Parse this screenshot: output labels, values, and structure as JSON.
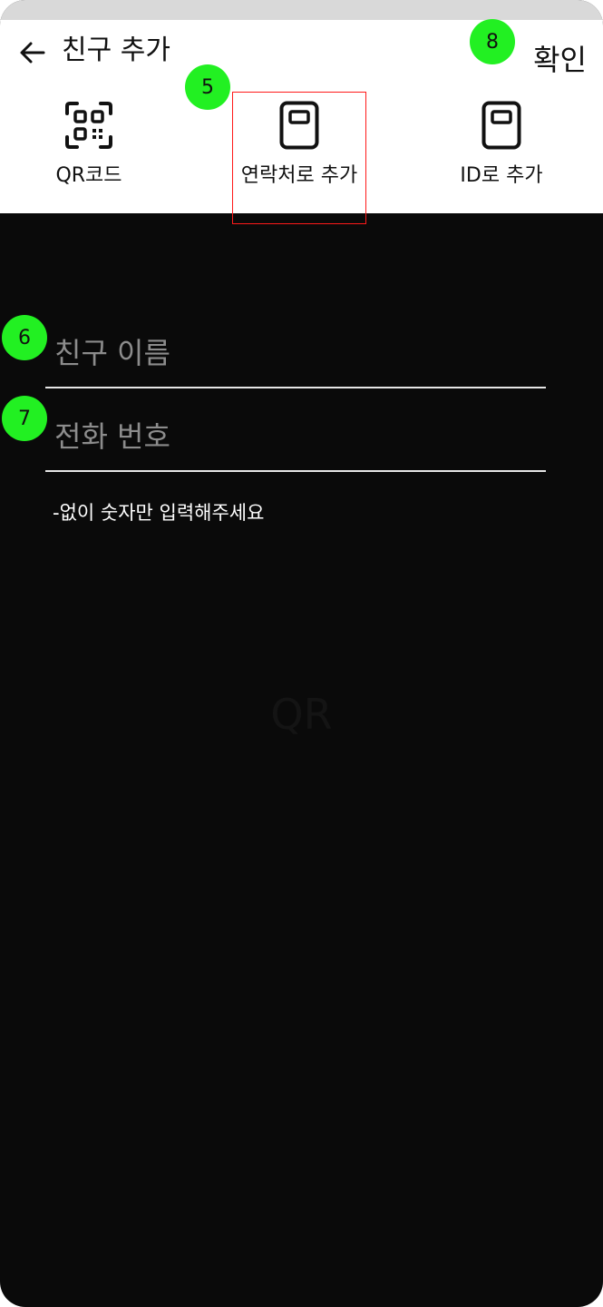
{
  "header": {
    "title": "친구 추가",
    "confirm_label": "확인",
    "back_icon": "arrow-left-icon"
  },
  "tabs": [
    {
      "label": "QR코드",
      "icon": "qr-code-icon"
    },
    {
      "label": "연락처로 추가",
      "icon": "contact-book-icon",
      "selected": true
    },
    {
      "label": "ID로 추가",
      "icon": "contact-book-icon"
    }
  ],
  "form": {
    "name_placeholder": "친구 이름",
    "name_value": "",
    "phone_placeholder": "전화 번호",
    "phone_value": "",
    "hint": "-없이 숫자만 입력해주세요"
  },
  "badges": {
    "contacts_tab": "5",
    "name_field": "6",
    "phone_field": "7",
    "confirm": "8"
  },
  "background_text": "QR",
  "colors": {
    "badge": "#22f022",
    "highlight_border": "#ff1a1a",
    "background": "#0a0a0a",
    "header": "#ffffff"
  }
}
